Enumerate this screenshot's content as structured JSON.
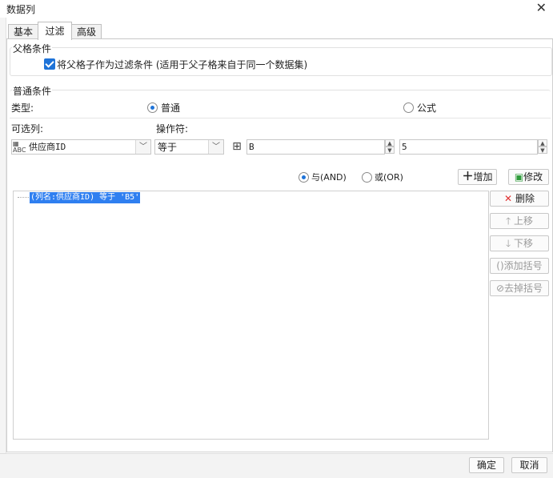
{
  "window": {
    "title": "数据列",
    "close_glyph": "✕"
  },
  "tabs": [
    {
      "label": "基本",
      "active": false
    },
    {
      "label": "过滤",
      "active": true
    },
    {
      "label": "高级",
      "active": false
    }
  ],
  "parent_condition": {
    "group_label": "父格条件",
    "checkbox_label": "将父格子作为过滤条件 (适用于父子格来自于同一个数据集)",
    "checked": true
  },
  "normal_condition": {
    "group_label": "普通条件",
    "type_label": "类型:",
    "type_options": [
      {
        "label": "普通",
        "checked": true
      },
      {
        "label": "公式",
        "checked": false
      }
    ],
    "column_label": "可选列:",
    "operator_label": "操作符:",
    "column_value": "供应商ID",
    "operator_value": "等于",
    "value_field": "B",
    "number_field": "5"
  },
  "logic": {
    "and_label": "与(AND)",
    "or_label": "或(OR)",
    "selected": "and"
  },
  "actions": {
    "add": "增加",
    "modify": "修改",
    "delete": "删除",
    "move_up": "上移",
    "move_down": "下移",
    "add_bracket": "添加括号",
    "remove_bracket": "去掉括号"
  },
  "conditions": [
    {
      "text": "(列名:供应商ID) 等于 'B5'",
      "selected": true
    }
  ],
  "footer": {
    "ok": "确定",
    "cancel": "取消"
  },
  "colors": {
    "accent": "#1e73d8",
    "selection": "#2f7ff0",
    "delete_red": "#e03030",
    "modify_green": "#2e9b3a"
  }
}
